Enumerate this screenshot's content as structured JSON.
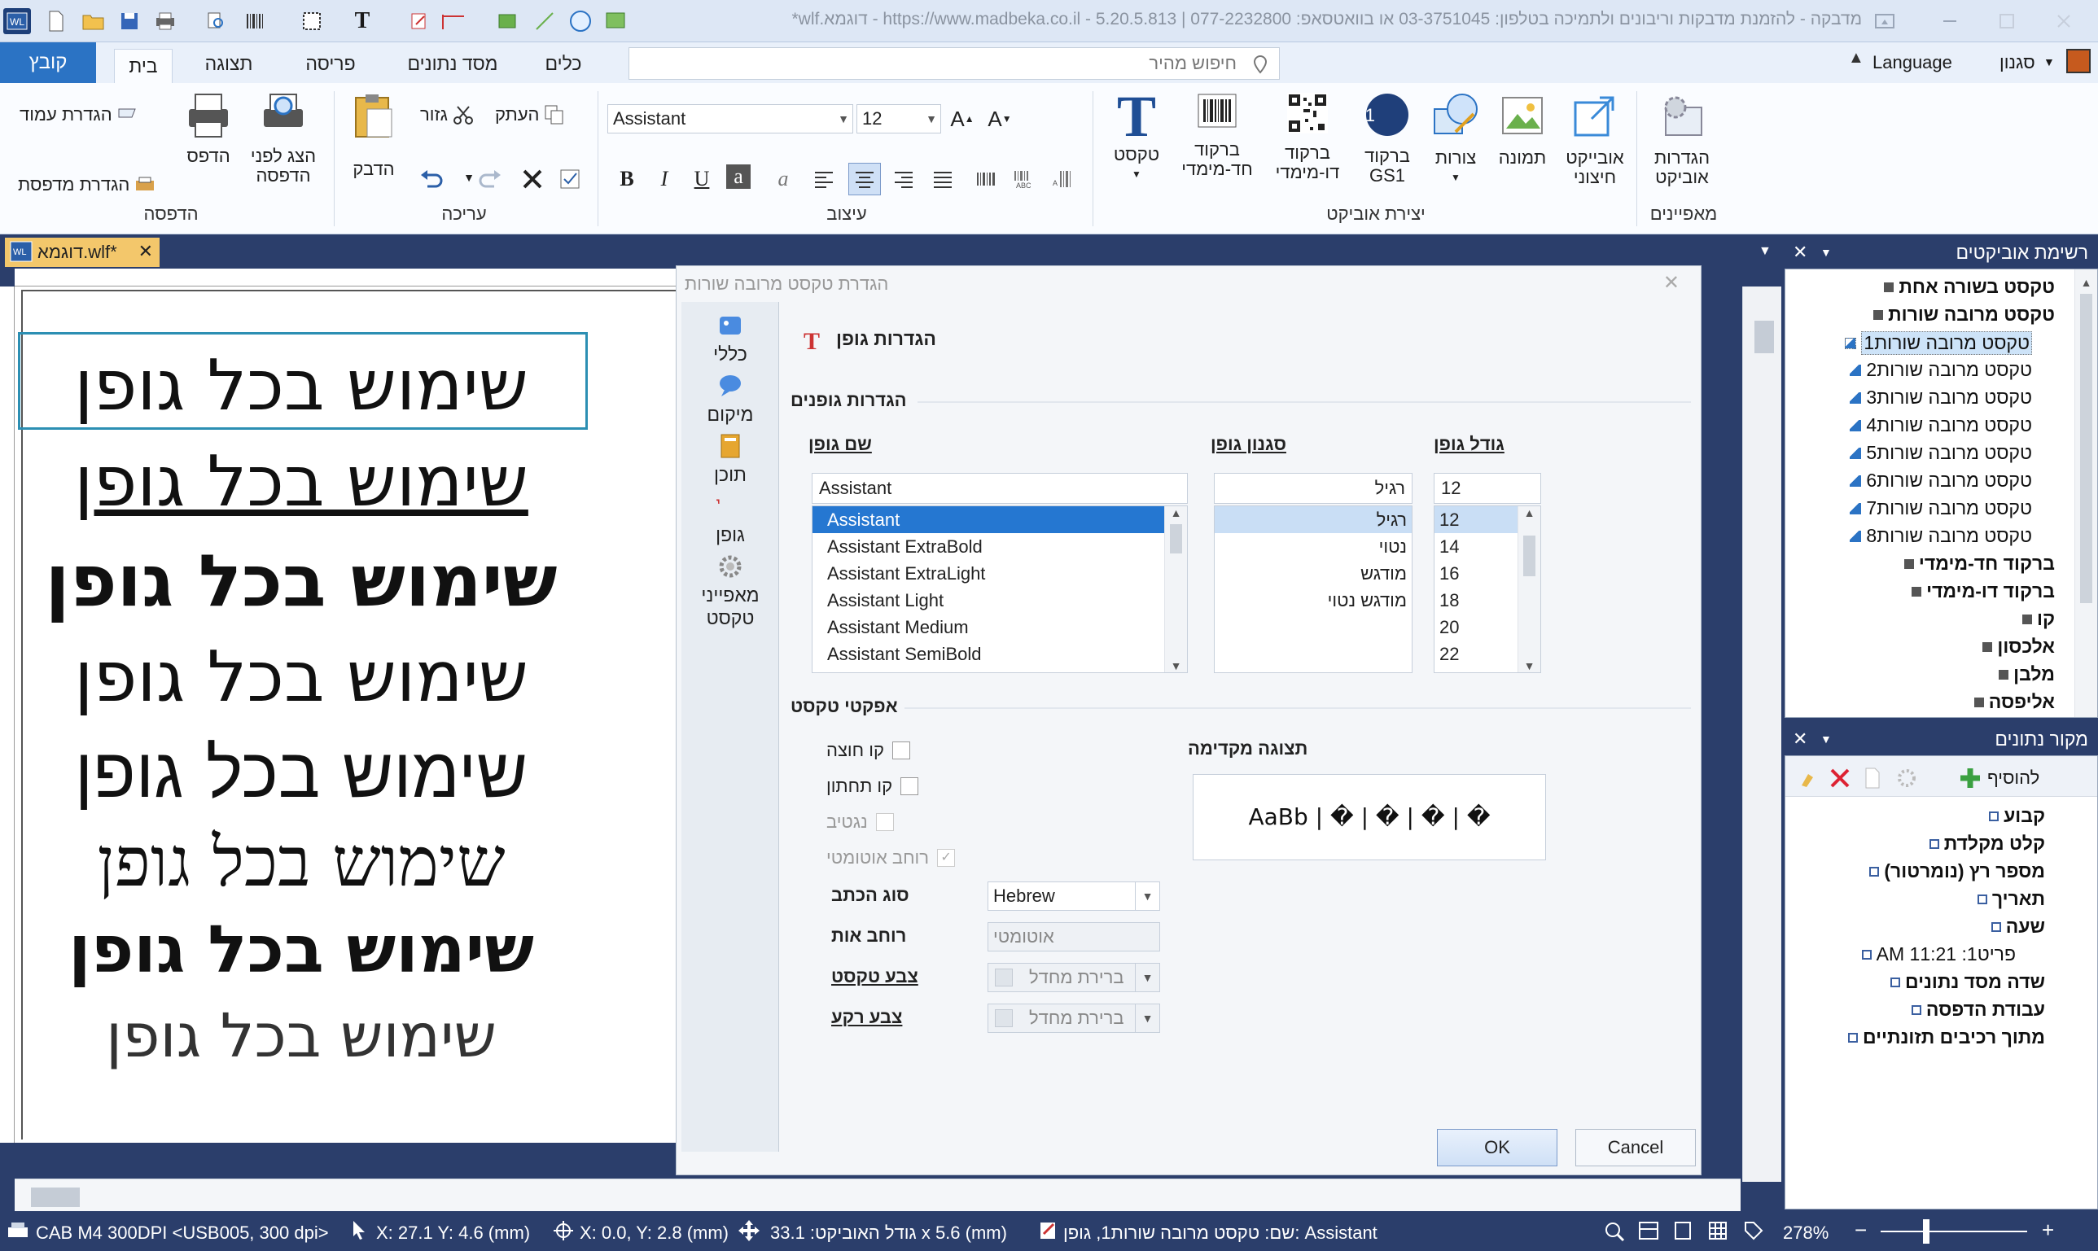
{
  "window": {
    "title": "מדבקה - להזמנת מדבקות וריבונים ולתמיכה בטלפון: 03-3751045 או בוואטסאפ: 077-2232800 | 5.20.5.813 - https://www.madbeka.co.il - דוגמא.wlf*",
    "language_label": "Language",
    "style_label": "סגנון"
  },
  "tabs": {
    "file": "קובץ",
    "home": "בית",
    "view": "תצוגה",
    "layout": "פריסה",
    "database": "מסד נתונים",
    "tools": "כלים"
  },
  "quick_search": {
    "placeholder": "חיפוש מהיר"
  },
  "ribbon": {
    "print_group": {
      "label": "הדפסה",
      "page_setup": "הגדרת עמוד",
      "printer_setup": "הגדרת מדפסת",
      "print": "הדפס",
      "print_preview": "הצג לפני הדפסה"
    },
    "edit_group": {
      "label": "עריכה",
      "paste": "הדבק",
      "cut": "גזור",
      "copy": "העתק"
    },
    "format_group": {
      "label": "עיצוב",
      "font_name": "Assistant",
      "font_size": "12"
    },
    "create_group": {
      "label": "יצירת אוביקט",
      "text": "טקסט",
      "barcode_1d_l1": "ברקוד",
      "barcode_1d_l2": "חד-מימדי",
      "barcode_2d_l1": "ברקוד",
      "barcode_2d_l2": "דו-מימדי",
      "barcode_gs1_l1": "ברקוד",
      "barcode_gs1_l2": "GS1",
      "shapes": "צורות",
      "image": "תמונה",
      "external_l1": "אובייקט",
      "external_l2": "חיצוני"
    },
    "properties_group": {
      "label": "מאפיינים",
      "object_settings_l1": "הגדרות",
      "object_settings_l2": "אוביקט"
    }
  },
  "document_tab": {
    "name": "דוגמא.wlf*"
  },
  "canvas": {
    "samples": [
      "שימוש בכל גופן",
      "שימוש בכל גופן",
      "שימוש בכל גופן",
      "שימוש בכל גופן",
      "שימוש בכל גופן",
      "שימוש בכל גופן",
      "שימוש בכל גופן",
      "שימוש בכל גופן"
    ]
  },
  "dialog": {
    "title": "הגדרת טקסט מרובה שורות",
    "nav": {
      "general": "כללי",
      "position": "מיקום",
      "content": "תוכן",
      "font": "גופן",
      "text_props_l1": "מאפייני",
      "text_props_l2": "טקסט"
    },
    "header": "הגדרות גופן",
    "fonts_section": "הגדרות גופנים",
    "font_name_label": "שם גופן",
    "font_style_label": "סגנון גופן",
    "font_size_label": "גודל גופן",
    "font_name_value": "Assistant",
    "font_style_value": "רגיל",
    "font_size_value": "12",
    "font_list": [
      "Assistant",
      "Assistant ExtraBold",
      "Assistant ExtraLight",
      "Assistant Light",
      "Assistant Medium",
      "Assistant SemiBold"
    ],
    "style_list": [
      "רגיל",
      "נטוי",
      "מודגש",
      "מודגש נטוי"
    ],
    "size_list": [
      "12",
      "14",
      "16",
      "18",
      "20",
      "22"
    ],
    "effects_section": "אפקטי טקסט",
    "strikeout": "קו חוצה",
    "underline": "קו תחתון",
    "negative": "נגטיב",
    "auto_width": "רוחב אוטומטי",
    "script_label": "סוג הכתב",
    "script_value": "Hebrew",
    "char_width_label": "רוחב אות",
    "char_width_value": "אוטומטי",
    "text_color_label": "צבע טקסט",
    "text_color_value": "ברירת מחדל",
    "bg_color_label": "צבע רקע",
    "bg_color_value": "ברירת מחדל",
    "preview_label": "תצוגה מקדימה",
    "preview_text": "AaBb | � | � | � | �",
    "ok": "OK",
    "cancel": "Cancel"
  },
  "objects_panel": {
    "title": "רשימת אוביקטים",
    "items": [
      {
        "label": "טקסט בשורה אחת",
        "bold": true,
        "level": 0
      },
      {
        "label": "טקסט מרובה שורות",
        "bold": true,
        "level": 0
      },
      {
        "label": "טקסט מרובה שורות1",
        "bold": false,
        "level": 1
      },
      {
        "label": "טקסט מרובה שורות2",
        "bold": false,
        "level": 1
      },
      {
        "label": "טקסט מרובה שורות3",
        "bold": false,
        "level": 1
      },
      {
        "label": "טקסט מרובה שורות4",
        "bold": false,
        "level": 1
      },
      {
        "label": "טקסט מרובה שורות5",
        "bold": false,
        "level": 1
      },
      {
        "label": "טקסט מרובה שורות6",
        "bold": false,
        "level": 1
      },
      {
        "label": "טקסט מרובה שורות7",
        "bold": false,
        "level": 1
      },
      {
        "label": "טקסט מרובה שורות8",
        "bold": false,
        "level": 1
      },
      {
        "label": "ברקוד חד-מימדי",
        "bold": true,
        "level": 0
      },
      {
        "label": "ברקוד דו-מימדי",
        "bold": true,
        "level": 0
      },
      {
        "label": "קו",
        "bold": true,
        "level": 0
      },
      {
        "label": "אלכסון",
        "bold": true,
        "level": 0
      },
      {
        "label": "מלבן",
        "bold": true,
        "level": 0
      },
      {
        "label": "אליפסה",
        "bold": true,
        "level": 0
      }
    ]
  },
  "datasource_panel": {
    "title": "מקור נתונים",
    "add": "להוסיף",
    "items": [
      {
        "label": "קבוע",
        "level": 0
      },
      {
        "label": "קלט מקלדת",
        "level": 0
      },
      {
        "label": "מספר רץ (נומרטור)",
        "level": 0
      },
      {
        "label": "תאריך",
        "level": 0
      },
      {
        "label": "שעה",
        "level": 0
      },
      {
        "label": "פריט1: 11:21 AM",
        "level": 1
      },
      {
        "label": "שדה מסד נתונים",
        "level": 0
      },
      {
        "label": "עבודת הדפסה",
        "level": 0
      },
      {
        "label": "מתוך רכיבים תזונתיים",
        "level": 0
      }
    ]
  },
  "status": {
    "printer": "CAB M4 300DPI <USB005, 300 dpi>",
    "cursor": "X: 27.1  Y: 4.6 (mm)",
    "offset": "X: 0.0, Y: 2.8 (mm)",
    "size": "33.1 :גודל האוביקט x 5.6 (mm)",
    "object": "שם: טקסט מרובה שורות1, גופן: Assistant",
    "zoom": "278%"
  },
  "colors": {
    "accent": "#2b73c4",
    "chrome": "#2b3e6b",
    "selection": "#2577d1"
  }
}
